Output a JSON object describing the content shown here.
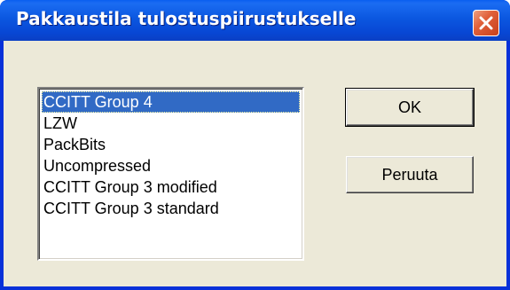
{
  "window": {
    "title": "Pakkaustila tulostuspiirustukselle",
    "close_icon": "close-icon"
  },
  "listbox": {
    "items": [
      "CCITT Group 4",
      "LZW",
      "PackBits",
      "Uncompressed",
      "CCITT Group 3 modified",
      "CCITT Group 3 standard"
    ],
    "selected_index": 0,
    "selected_color": "#316ac5"
  },
  "buttons": {
    "ok_label": "OK",
    "cancel_label": "Peruuta"
  },
  "colors": {
    "titlebar": "#0b57e0",
    "client_bg": "#ece9d8",
    "close_button": "#e0603a"
  }
}
